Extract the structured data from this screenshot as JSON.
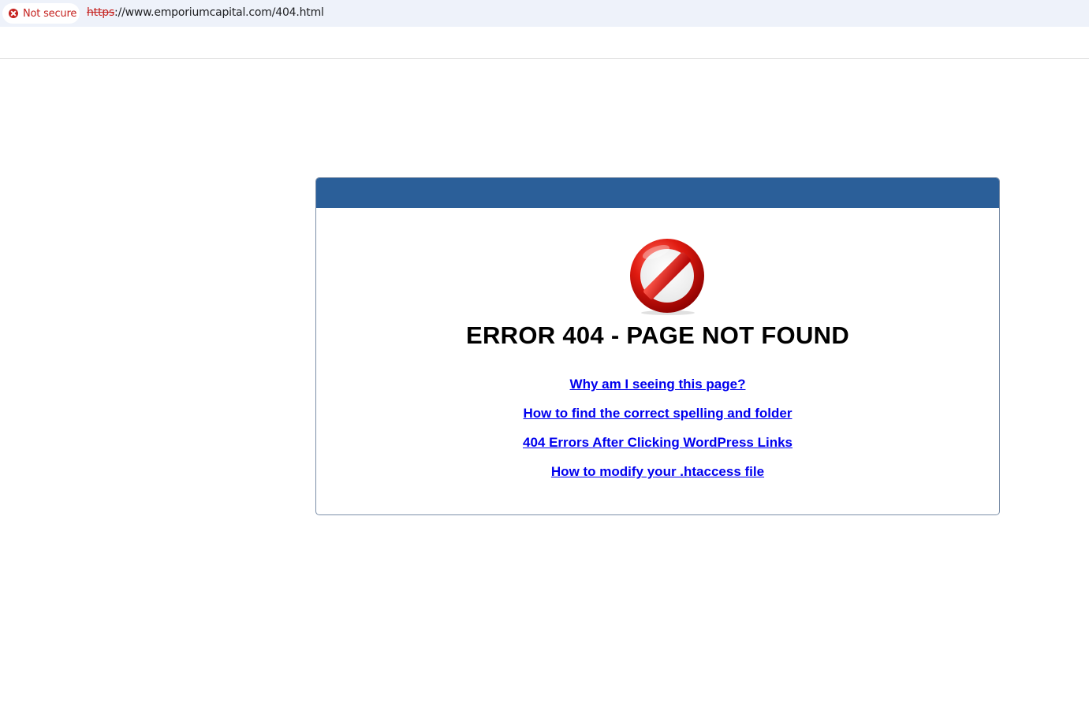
{
  "browser": {
    "security_label": "Not secure",
    "url_scheme": "https",
    "url_rest": "://www.emporiumcapital.com/404.html",
    "icons": {
      "security": "not-secure-warning-icon"
    }
  },
  "page": {
    "title": "ERROR 404 - PAGE NOT FOUND",
    "icon": "stop-sign-icon",
    "links": [
      "Why am I seeing this page?",
      "How to find the correct spelling and folder",
      "404 Errors After Clicking WordPress Links",
      "How to modify your .htaccess file"
    ],
    "colors": {
      "header": "#2b5f99",
      "link": "#0000ee",
      "warning": "#c5221f",
      "sign": "#cc0000"
    }
  }
}
